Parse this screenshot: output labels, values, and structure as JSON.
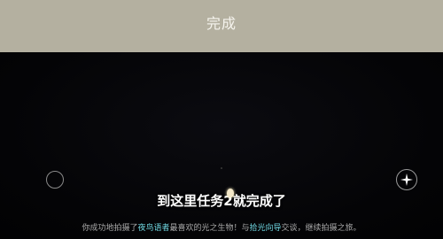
{
  "header": {
    "done_label": "完成"
  },
  "subtitle": "到这里任务2就完成了",
  "description": {
    "part1": "你成功地拍摄了",
    "creature": "夜鸟语者",
    "part2": "最喜欢的光之生物！与",
    "guide": "拾光向导",
    "part3": "交谈，继续拍摄之旅。"
  },
  "colors": {
    "header_bg": "#b4b0a0",
    "highlight": "#6fd6e0"
  },
  "icons": {
    "left_button": "circle-outline-icon",
    "right_button": "sparkle-icon"
  }
}
